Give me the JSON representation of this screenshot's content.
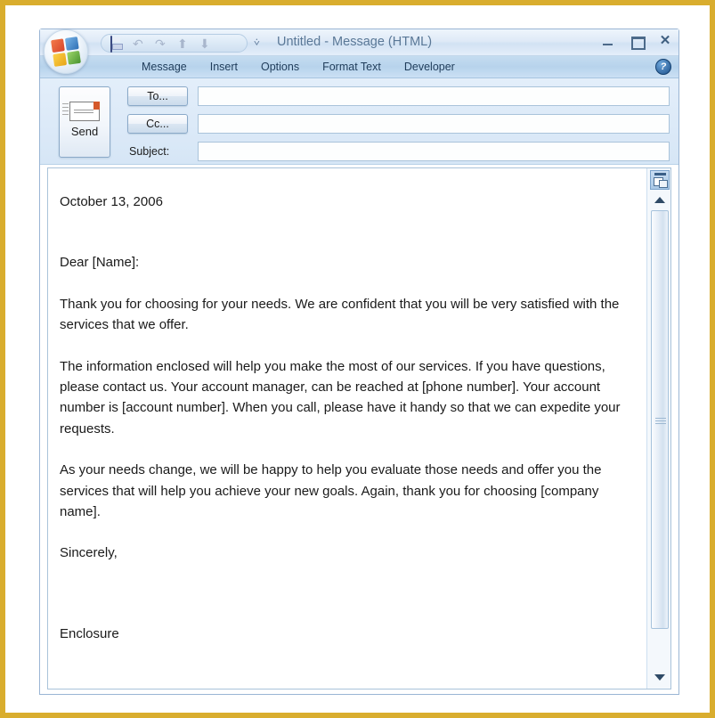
{
  "window": {
    "title": "Untitled  -  Message (HTML)",
    "office_button": "office-orb",
    "controls": {
      "minimize": "–",
      "maximize": "□",
      "close": "✕"
    }
  },
  "quick_access_toolbar": {
    "items": [
      {
        "name": "save",
        "icon": "floppy-disk-icon"
      },
      {
        "name": "undo",
        "icon": "undo-arrow-icon",
        "glyph": "↶"
      },
      {
        "name": "redo",
        "icon": "redo-arrow-icon",
        "glyph": "↷"
      },
      {
        "name": "previous",
        "icon": "previous-item-icon",
        "glyph": "⬆"
      },
      {
        "name": "next",
        "icon": "next-item-icon",
        "glyph": "⬇"
      }
    ],
    "customize_glyph": "⩒"
  },
  "ribbon": {
    "tabs": [
      {
        "label": "Message"
      },
      {
        "label": "Insert"
      },
      {
        "label": "Options"
      },
      {
        "label": "Format Text"
      },
      {
        "label": "Developer"
      }
    ],
    "help_glyph": "?"
  },
  "compose": {
    "send_label": "Send",
    "send_icon": "envelope-icon",
    "to_label": "To...",
    "cc_label": "Cc...",
    "subject_label": "Subject:",
    "to_value": "",
    "cc_value": "",
    "subject_value": "",
    "to_placeholder": "",
    "cc_placeholder": "",
    "subject_placeholder": ""
  },
  "body": {
    "date": "October 13, 2006",
    "salutation": "Dear [Name]:",
    "paragraph1": "Thank you for choosing for your needs. We are confident that you will be very satisfied with the services that we offer.",
    "paragraph2": "The information enclosed will help you make the most of our services. If you have questions, please contact us. Your account manager, can be reached at [phone number]. Your account number is [account number]. When you call, please have it handy so that we can expedite your requests.",
    "paragraph3": "As your needs change, we will be happy to help you evaluate those needs and offer you the services that will help you achieve your new goals. Again, thank you for choosing [company name].",
    "closing": "Sincerely,",
    "enclosure": "Enclosure"
  },
  "scrollbar": {
    "browse_object_icon": "select-browse-object-icon",
    "up_arrow": "scroll-up-arrow-icon",
    "down_arrow": "scroll-down-arrow-icon"
  },
  "colors": {
    "page_border": "#d9ad2e",
    "ribbon_tabs": "#b7d3ec",
    "header_bg": "#dceafa",
    "title_text": "#5a7897",
    "body_text": "#1a1a1a",
    "field_border": "#a9c3da"
  }
}
